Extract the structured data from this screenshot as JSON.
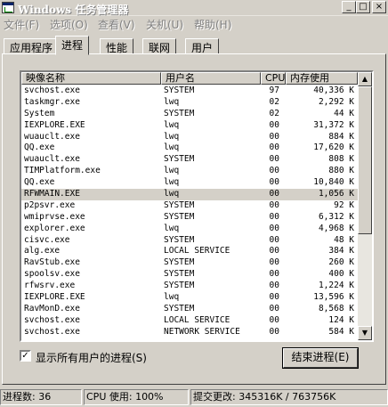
{
  "window": {
    "title": "Windows 任务管理器",
    "buttons": {
      "minimize": "_",
      "maximize": "□",
      "close": "×"
    }
  },
  "menu": [
    "文件(F)",
    "选项(O)",
    "查看(V)",
    "关机(U)",
    "帮助(H)"
  ],
  "tabs": [
    "应用程序",
    "进程",
    "性能",
    "联网",
    "用户"
  ],
  "active_tab": "进程",
  "columns": {
    "name": "映像名称",
    "user": "用户名",
    "cpu": "CPU",
    "mem": "内存使用"
  },
  "processes": [
    {
      "name": "svchost.exe",
      "user": "SYSTEM",
      "cpu": "97",
      "mem": "40,336 K"
    },
    {
      "name": "taskmgr.exe",
      "user": "lwq",
      "cpu": "02",
      "mem": "2,292 K"
    },
    {
      "name": "System",
      "user": "SYSTEM",
      "cpu": "02",
      "mem": "44 K"
    },
    {
      "name": "IEXPLORE.EXE",
      "user": "lwq",
      "cpu": "00",
      "mem": "31,372 K"
    },
    {
      "name": "wuauclt.exe",
      "user": "lwq",
      "cpu": "00",
      "mem": "884 K"
    },
    {
      "name": "QQ.exe",
      "user": "lwq",
      "cpu": "00",
      "mem": "17,620 K"
    },
    {
      "name": "wuauclt.exe",
      "user": "SYSTEM",
      "cpu": "00",
      "mem": "808 K"
    },
    {
      "name": "TIMPlatform.exe",
      "user": "lwq",
      "cpu": "00",
      "mem": "880 K"
    },
    {
      "name": "QQ.exe",
      "user": "lwq",
      "cpu": "00",
      "mem": "10,840 K"
    },
    {
      "name": "RFWMAIN.EXE",
      "user": "lwq",
      "cpu": "00",
      "mem": "1,056 K",
      "selected": true
    },
    {
      "name": "p2psvr.exe",
      "user": "SYSTEM",
      "cpu": "00",
      "mem": "92 K"
    },
    {
      "name": "wmiprvse.exe",
      "user": "SYSTEM",
      "cpu": "00",
      "mem": "6,312 K"
    },
    {
      "name": "explorer.exe",
      "user": "lwq",
      "cpu": "00",
      "mem": "4,968 K"
    },
    {
      "name": "cisvc.exe",
      "user": "SYSTEM",
      "cpu": "00",
      "mem": "48 K"
    },
    {
      "name": "alg.exe",
      "user": "LOCAL SERVICE",
      "cpu": "00",
      "mem": "384 K"
    },
    {
      "name": "RavStub.exe",
      "user": "SYSTEM",
      "cpu": "00",
      "mem": "260 K"
    },
    {
      "name": "spoolsv.exe",
      "user": "SYSTEM",
      "cpu": "00",
      "mem": "400 K"
    },
    {
      "name": "rfwsrv.exe",
      "user": "SYSTEM",
      "cpu": "00",
      "mem": "1,224 K"
    },
    {
      "name": "IEXPLORE.EXE",
      "user": "lwq",
      "cpu": "00",
      "mem": "13,596 K"
    },
    {
      "name": "RavMonD.exe",
      "user": "SYSTEM",
      "cpu": "00",
      "mem": "8,568 K"
    },
    {
      "name": "svchost.exe",
      "user": "LOCAL SERVICE",
      "cpu": "00",
      "mem": "124 K"
    },
    {
      "name": "svchost.exe",
      "user": "NETWORK SERVICE",
      "cpu": "00",
      "mem": "584 K"
    }
  ],
  "show_all_users": {
    "label": "显示所有用户的进程(S)",
    "checked": true
  },
  "end_process_label": "结束进程(E)",
  "status": {
    "processes": "进程数: 36",
    "cpu": "CPU 使用: 100%",
    "commit": "提交更改: 345316K / 763756K"
  },
  "colors": {
    "titlebar_inactive": "#d4d0c8",
    "face": "#d4d0c8",
    "selection": "#d4d0c8"
  },
  "icons": [
    "taskmgr-app-icon",
    "checkmark-icon",
    "scroll-up-arrow-icon",
    "scroll-down-arrow-icon"
  ]
}
